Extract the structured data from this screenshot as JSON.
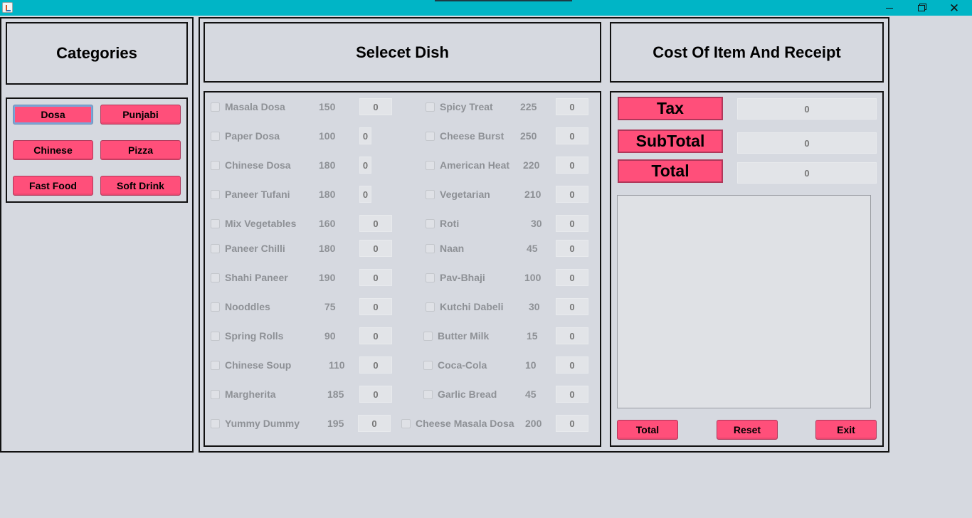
{
  "window": {
    "minimize_glyph": "",
    "close_glyph": "✕"
  },
  "categories": {
    "title": "Categories",
    "buttons": [
      "Dosa",
      "Punjabi",
      "Chinese",
      "Pizza",
      "Fast Food",
      "Soft Drink"
    ]
  },
  "dishes": {
    "title": "Selecet Dish",
    "left": [
      {
        "name": "Masala Dosa",
        "price": "150",
        "qty": "0"
      },
      {
        "name": "Paper Dosa",
        "price": "100",
        "qty": "0"
      },
      {
        "name": "Chinese Dosa",
        "price": "180",
        "qty": "0"
      },
      {
        "name": "Paneer Tufani",
        "price": "180",
        "qty": "0"
      },
      {
        "name": "Mix Vegetables",
        "price": "160",
        "qty": "0"
      },
      {
        "name": "Paneer Chilli",
        "price": "180",
        "qty": "0"
      },
      {
        "name": "Shahi Paneer",
        "price": "190",
        "qty": "0"
      },
      {
        "name": "Nooddles",
        "price": "75",
        "qty": "0"
      },
      {
        "name": "Spring Rolls",
        "price": "90",
        "qty": "0"
      },
      {
        "name": "Chinese Soup",
        "price": "110",
        "qty": "0"
      },
      {
        "name": "Margherita",
        "price": "185",
        "qty": "0"
      },
      {
        "name": "Yummy Dummy",
        "price": "195",
        "qty": "0"
      }
    ],
    "right": [
      {
        "name": "Spicy Treat",
        "price": "225",
        "qty": "0"
      },
      {
        "name": "Cheese Burst",
        "price": "250",
        "qty": "0"
      },
      {
        "name": "American Heat",
        "price": "220",
        "qty": "0"
      },
      {
        "name": "Vegetarian",
        "price": "210",
        "qty": "0"
      },
      {
        "name": "Roti",
        "price": "30",
        "qty": "0"
      },
      {
        "name": "Naan",
        "price": "45",
        "qty": "0"
      },
      {
        "name": "Pav-Bhaji",
        "price": "100",
        "qty": "0"
      },
      {
        "name": "Kutchi Dabeli",
        "price": "30",
        "qty": "0"
      },
      {
        "name": "Butter Milk",
        "price": "15",
        "qty": "0"
      },
      {
        "name": "Coca-Cola",
        "price": "10",
        "qty": "0"
      },
      {
        "name": "Garlic Bread",
        "price": "45",
        "qty": "0"
      },
      {
        "name": "Cheese Masala Dosa",
        "price": "200",
        "qty": "0"
      }
    ]
  },
  "cost": {
    "title": "Cost Of Item And Receipt",
    "tax_label": "Tax",
    "tax_value": "0",
    "subtotal_label": "SubTotal",
    "subtotal_value": "0",
    "total_label": "Total",
    "total_value": "0",
    "receipt_text": "",
    "buttons": {
      "total": "Total",
      "reset": "Reset",
      "exit": "Exit"
    }
  },
  "colors": {
    "titlebar": "#00b5c6",
    "accent_button": "#ff4f7a",
    "background": "#d6d9e0"
  }
}
